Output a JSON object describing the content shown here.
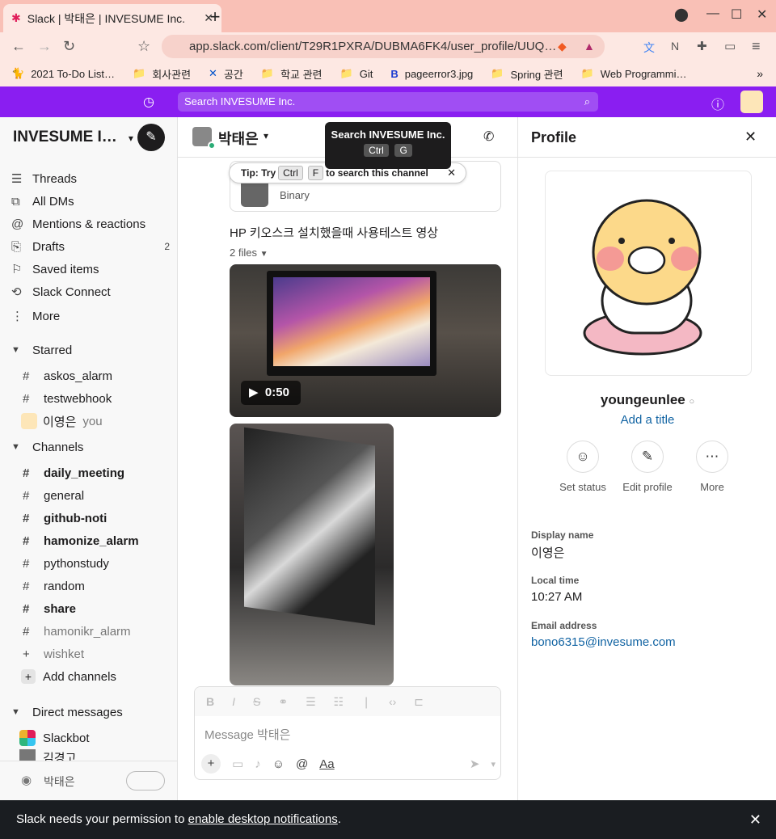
{
  "browser": {
    "tab_title": "Slack | 박태은 | INVESUME Inc.",
    "url": "app.slack.com/client/T29R1PXRA/DUBMA6FK4/user_profile/UUQ…",
    "bookmarks": [
      "2021 To-Do List…",
      "회사관련",
      "공간",
      "학교 관련",
      "Git",
      "pageerror3.jpg",
      "Spring 관련",
      "Web Programmi…"
    ]
  },
  "slack": {
    "search_placeholder": "Search INVESUME Inc.",
    "workspace": "INVESUME I…",
    "nav": [
      {
        "label": "Threads",
        "icon": "threads-icon"
      },
      {
        "label": "All DMs",
        "icon": "dms-icon"
      },
      {
        "label": "Mentions & reactions",
        "icon": "at-icon"
      },
      {
        "label": "Drafts",
        "icon": "drafts-icon",
        "count": "2"
      },
      {
        "label": "Saved items",
        "icon": "bookmark-icon"
      },
      {
        "label": "Slack Connect",
        "icon": "connect-icon"
      },
      {
        "label": "More",
        "icon": "more-vertical-icon"
      }
    ],
    "starred_label": "Starred",
    "starred": [
      "askos_alarm",
      "testwebhook"
    ],
    "starred_dm": {
      "name": "이영은",
      "suffix": "you"
    },
    "channels_label": "Channels",
    "channels": [
      {
        "name": "daily_meeting",
        "bold": true
      },
      {
        "name": "general",
        "bold": false
      },
      {
        "name": "github-noti",
        "bold": true
      },
      {
        "name": "hamonize_alarm",
        "bold": true
      },
      {
        "name": "pythonstudy",
        "bold": false
      },
      {
        "name": "random",
        "bold": false
      },
      {
        "name": "share",
        "bold": true
      },
      {
        "name": "hamonikr_alarm",
        "muted": true
      },
      {
        "name": "wishket",
        "muted": true
      }
    ],
    "add_channels": "Add channels",
    "dm_label": "Direct messages",
    "dms": [
      "Slackbot",
      "김경고"
    ],
    "sidebar_user": "박태은"
  },
  "channel": {
    "name": "박태은",
    "tooltip_title": "Search INVESUME Inc.",
    "tooltip_keys": [
      "Ctrl",
      "G"
    ],
    "tip_prefix": "Tip: Try",
    "tip_keys": [
      "Ctrl",
      "F"
    ],
    "tip_suffix": "to search this channel",
    "file_type": "Binary",
    "message": "HP 키오스크 설치했을때 사용테스트 영상",
    "files_count": "2 files",
    "video1_duration": "0:50",
    "composer_placeholder": "Message 박태은"
  },
  "profile": {
    "header": "Profile",
    "username": "youngeunlee",
    "add_title": "Add a title",
    "actions": [
      {
        "label": "Set status",
        "icon": "smile-icon"
      },
      {
        "label": "Edit profile",
        "icon": "pencil-icon"
      },
      {
        "label": "More",
        "icon": "ellipsis-icon"
      }
    ],
    "fields": [
      {
        "label": "Display name",
        "value": "이영은"
      },
      {
        "label": "Local time",
        "value": "10:27 AM"
      },
      {
        "label": "Email address",
        "value": "bono6315@invesume.com"
      }
    ]
  },
  "notification": {
    "prefix": "Slack needs your permission to ",
    "link": "enable desktop notifications",
    "suffix": "."
  },
  "colors": {
    "accent": "#8a1ef1",
    "link": "#1264a3"
  }
}
